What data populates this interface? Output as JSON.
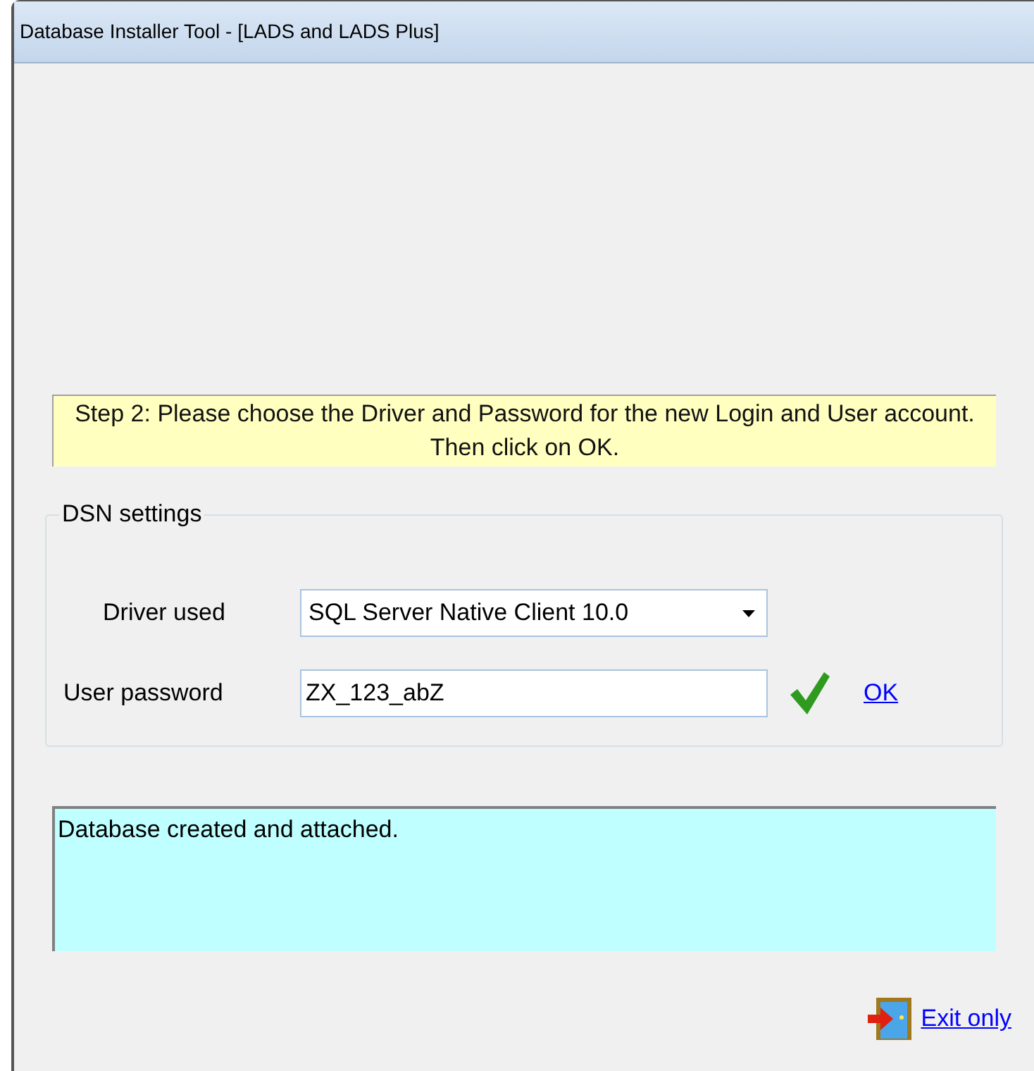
{
  "window": {
    "title": "Database Installer Tool - [LADS and LADS Plus]"
  },
  "instruction": "Step 2: Please choose the Driver and Password for the new Login and User account. Then click on OK.",
  "dsn_settings": {
    "title": "DSN settings",
    "driver": {
      "label": "Driver used",
      "value": "SQL Server Native Client 10.0"
    },
    "password": {
      "label": "User password",
      "value": "ZX_123_abZ",
      "valid": true
    },
    "ok_link": "OK"
  },
  "log": "Database created and attached.",
  "exit_link": "Exit only"
}
